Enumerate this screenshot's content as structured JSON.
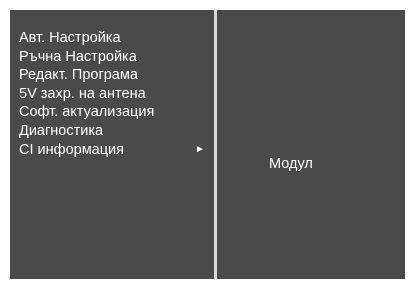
{
  "menu": {
    "items": [
      {
        "label": "Авт. Настройка"
      },
      {
        "label": "Ръчна Настройка"
      },
      {
        "label": "Редакт. Програма"
      },
      {
        "label": "5V захр. на антена"
      },
      {
        "label": "Софт. актуализация"
      },
      {
        "label": "Диагностика"
      },
      {
        "label": "CI информация",
        "arrow": "►"
      }
    ],
    "selected_index": 6
  },
  "submenu": {
    "items": [
      {
        "label": "Модул"
      }
    ]
  },
  "colors": {
    "panel_background": "#4a4a4a",
    "divider": "#d8d8d8",
    "text": "#ffffff",
    "page_background": "#ffffff"
  },
  "icons": {
    "submenu_arrow": "right-triangle-icon"
  }
}
